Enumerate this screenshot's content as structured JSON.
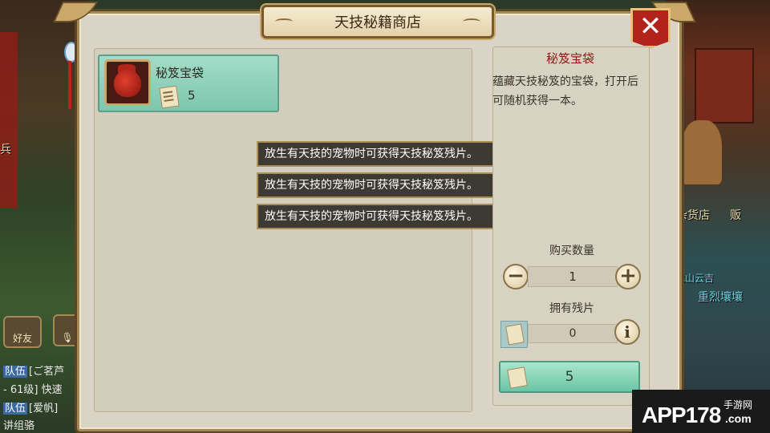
{
  "window": {
    "title": "天技秘籍商店",
    "close_label": "✕"
  },
  "shop_items": [
    {
      "name": "秘笈宝袋",
      "price": "5",
      "icon": "red-treasure-bag-icon",
      "selected": true
    }
  ],
  "notifications": [
    "放生有天技的宠物时可获得天技秘笈残片。",
    "放生有天技的宠物时可获得天技秘笈残片。",
    "放生有天技的宠物时可获得天技秘笈残片。"
  ],
  "detail": {
    "name": "秘笈宝袋",
    "description": "蕴藏天技秘笈的宝袋，打开后可随机获得一本。"
  },
  "purchase": {
    "quantity_label": "购买数量",
    "quantity": "1",
    "minus_label": "−",
    "plus_label": "+",
    "fragments_label": "拥有残片",
    "fragments_owned": "0",
    "info_label": "i",
    "buy_price": "5"
  },
  "background_hud": {
    "friends_label": "好友",
    "side_labels": [
      "杂货店",
      "贩",
      "龙山云吉",
      "重烈壤壤",
      "兵"
    ],
    "chat_lines": [
      {
        "tag": "队伍",
        "text": "[ご茗芦"
      },
      {
        "tag": "",
        "text": "- 61级] 快速"
      },
      {
        "tag": "队伍",
        "text": "[爱帆]"
      },
      {
        "tag": "",
        "text": "讲组骆"
      }
    ]
  },
  "watermark": {
    "brand": "APP178",
    "tagline": "手游网",
    "domain": ".com"
  },
  "colors": {
    "panel_bg": "#d9d4c6",
    "accent_teal": "#7dc6ad",
    "close_red": "#b2231c",
    "item_title_red": "#8c1a12",
    "toast_bg": "#3d3a34"
  }
}
